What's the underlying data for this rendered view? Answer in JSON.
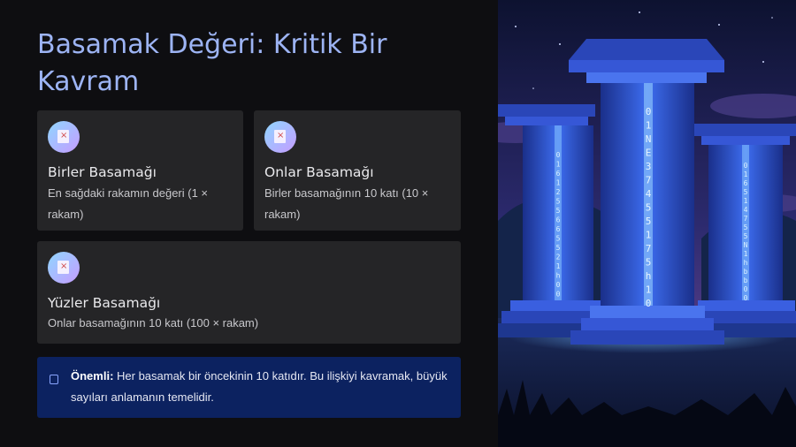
{
  "slide": {
    "title": "Basamak Değeri: Kritik Bir Kavram"
  },
  "cards": [
    {
      "title": "Birler Basamağı",
      "description": "En sağdaki rakamın değeri (1 × rakam)"
    },
    {
      "title": "Onlar Basamağı",
      "description": "Birler basamağının 10 katı (10 × rakam)"
    },
    {
      "title": "Yüzler Basamağı",
      "description": "Onlar basamağının 10 katı (100 × rakam)"
    }
  ],
  "note": {
    "label": "Önemli:",
    "text": " Her basamak bir öncekinin 10 katıdır. Bu ilişkiyi kavramak, büyük sayıları anlamanın temelidir."
  },
  "illustration": {
    "icon": "illustration-image",
    "center_column_digits": [
      "0",
      "1",
      "N",
      "E",
      "3",
      "7",
      "4",
      "5",
      "5",
      "1",
      "7",
      "5",
      "h",
      "1",
      "0"
    ],
    "left_column_digits": [
      "0",
      "1",
      "6",
      "1",
      "2",
      "5",
      "5",
      "6",
      "6",
      "5",
      "5",
      "2",
      "1",
      "h",
      "0",
      "0"
    ],
    "right_column_digits": [
      "0",
      "1",
      "6",
      "5",
      "1",
      "4",
      "7",
      "5",
      "5",
      "N",
      "1",
      "h",
      "b",
      "b",
      "0",
      "0"
    ]
  },
  "colors": {
    "background": "#0e0e11",
    "title": "#9db4f4",
    "card": "#252527",
    "note_background": "#0c2260"
  }
}
